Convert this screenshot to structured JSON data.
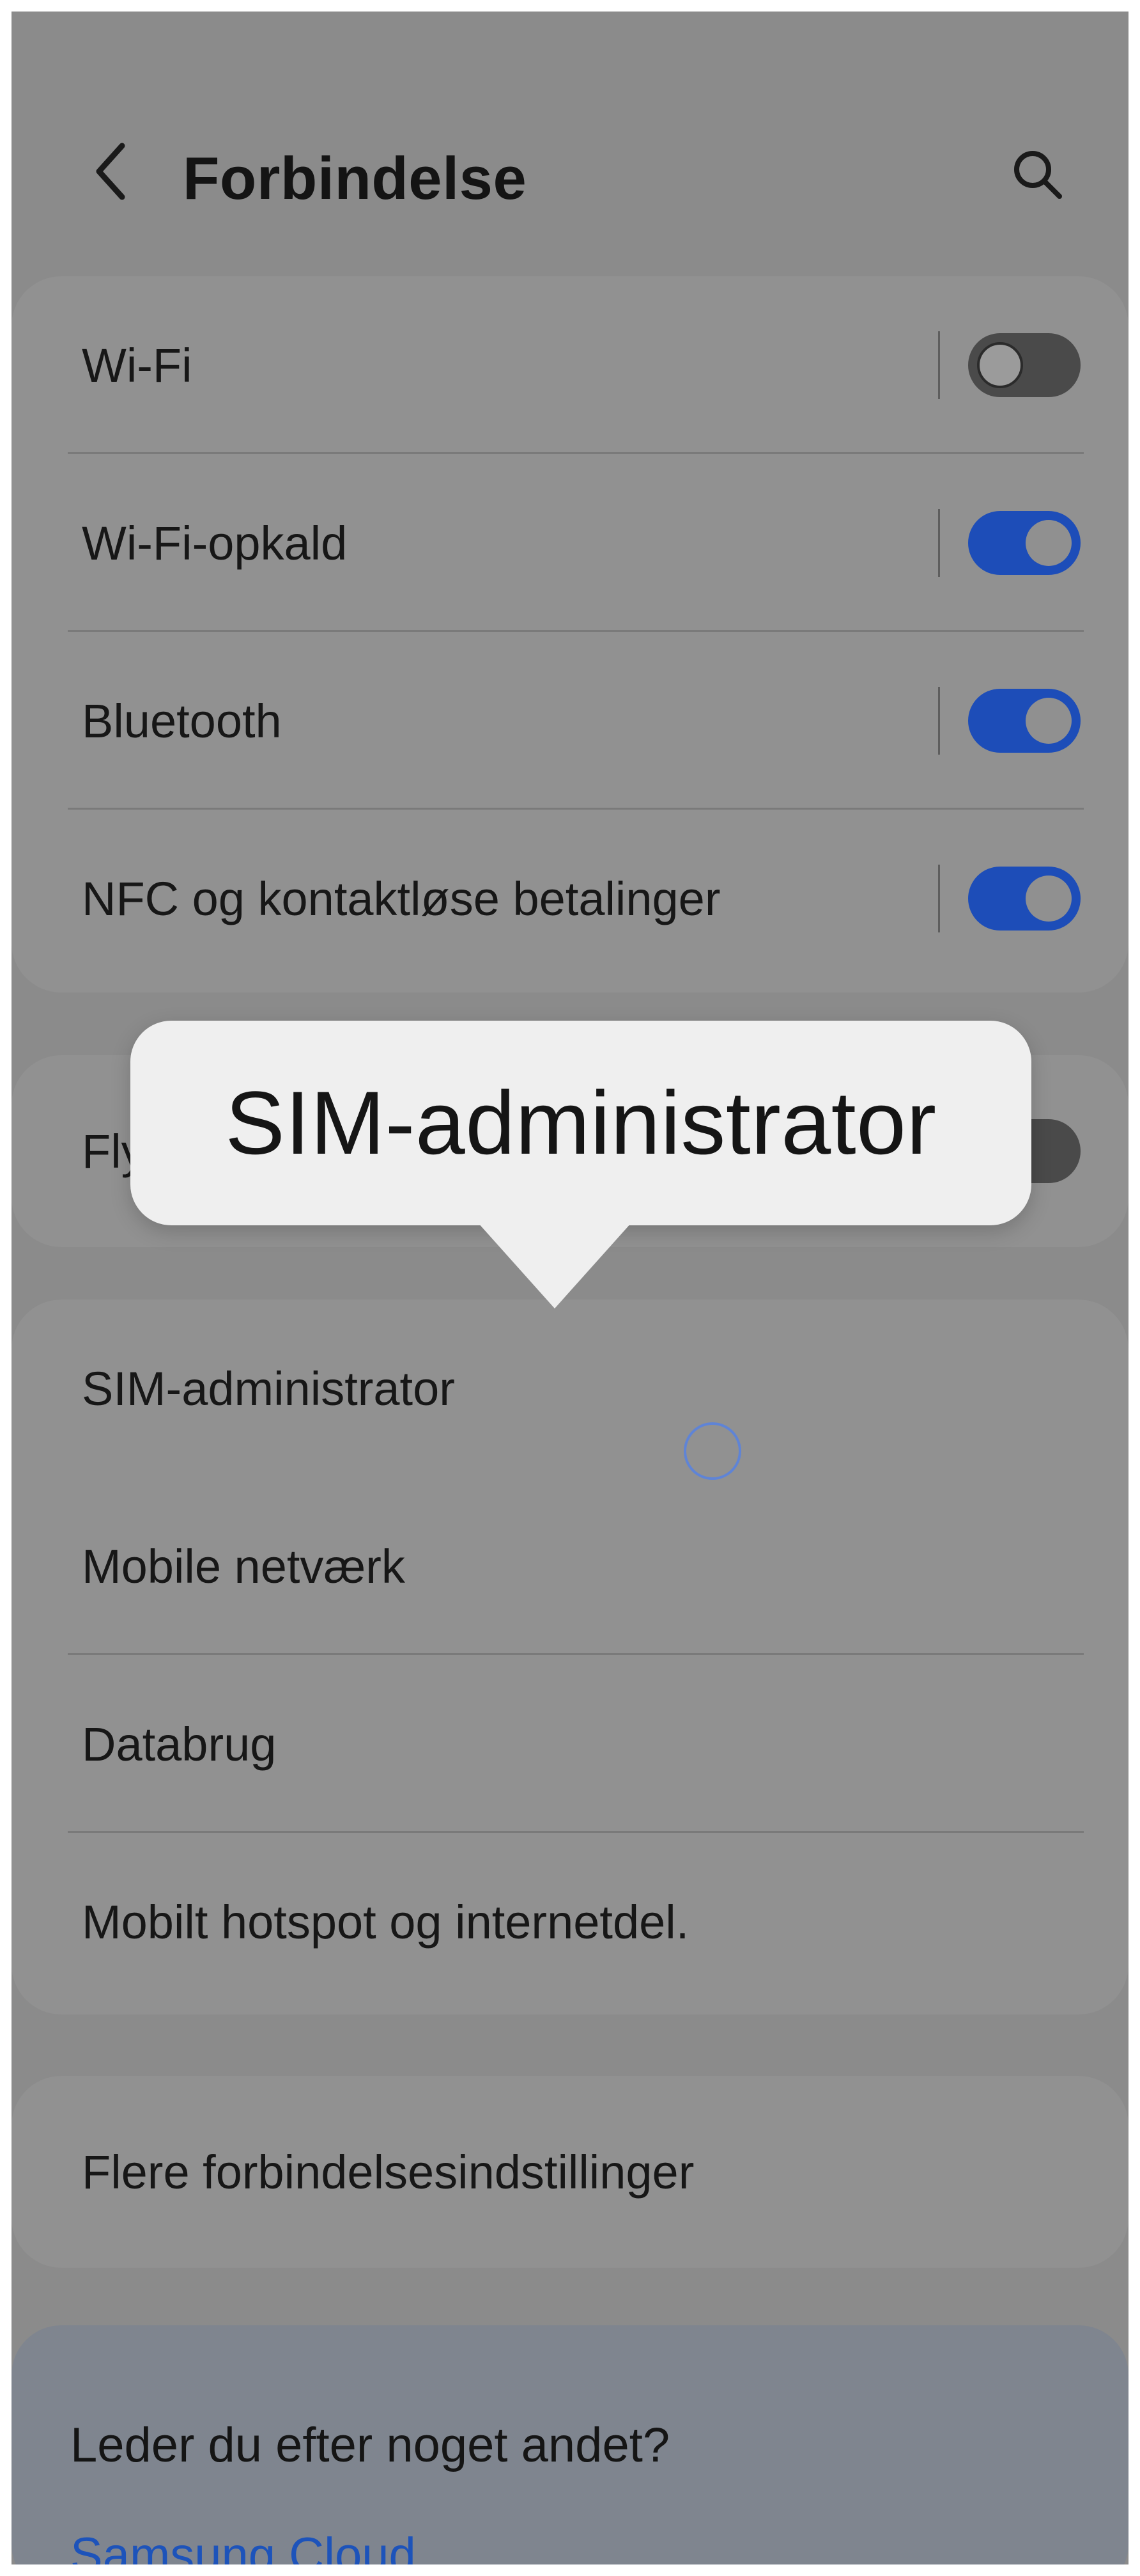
{
  "header": {
    "title": "Forbindelse"
  },
  "settings": {
    "items": [
      {
        "label": "Wi-Fi",
        "toggle": "off"
      },
      {
        "label": "Wi-Fi-opkald",
        "toggle": "on"
      },
      {
        "label": "Bluetooth",
        "toggle": "on"
      },
      {
        "label": "NFC og kontaktløse betalinger",
        "toggle": "on"
      },
      {
        "label": "Fly",
        "toggle": "off"
      },
      {
        "label": "SIM-administrator"
      },
      {
        "label": "Mobile netværk"
      },
      {
        "label": "Databrug"
      },
      {
        "label": "Mobilt hotspot og internetdel."
      },
      {
        "label": "Flere forbindelsesindstillinger"
      }
    ]
  },
  "tooltip": {
    "text": "SIM-administrator"
  },
  "help": {
    "title": "Leder du efter noget andet?",
    "link": "Samsung Cloud"
  },
  "colors": {
    "toggle_on": "#1d4db8",
    "link": "#1d53ba"
  },
  "icons": {
    "back": "chevron-left-icon",
    "search": "search-icon"
  }
}
